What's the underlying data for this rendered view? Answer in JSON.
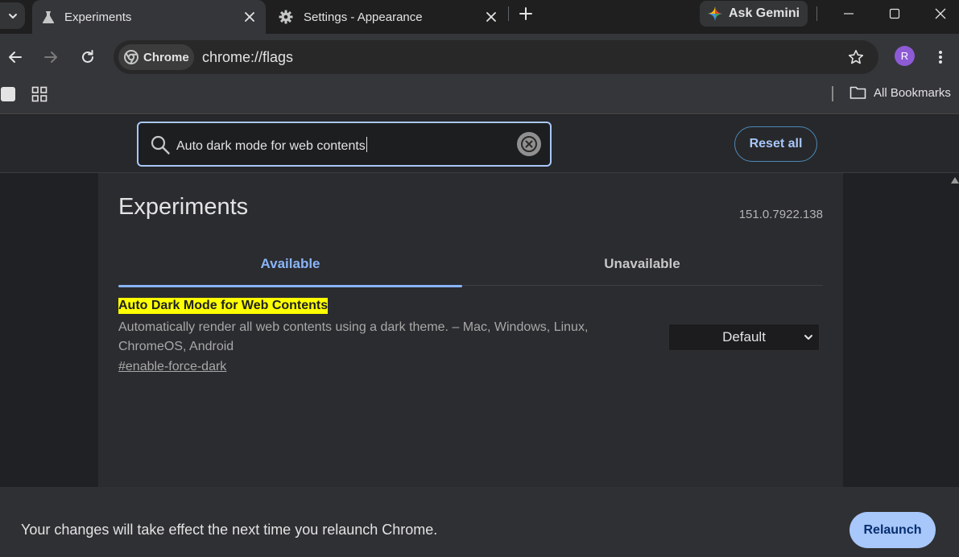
{
  "tabs": [
    {
      "title": "Experiments",
      "icon": "flask-icon",
      "active": true
    },
    {
      "title": "Settings - Appearance",
      "icon": "gear-icon",
      "active": false
    }
  ],
  "gemini": {
    "label": "Ask Gemini"
  },
  "omnibox": {
    "chip_label": "Chrome",
    "url": "chrome://flags"
  },
  "profile": {
    "initial": "R",
    "color": "#8e5bd6"
  },
  "bookmarks": {
    "all_label": "All Bookmarks"
  },
  "flags": {
    "search_value": "Auto dark mode for web contents",
    "reset_label": "Reset all",
    "page_title": "Experiments",
    "version": "151.0.7922.138",
    "tabs": [
      {
        "label": "Available",
        "selected": true
      },
      {
        "label": "Unavailable",
        "selected": false
      }
    ],
    "items": [
      {
        "name": "Auto Dark Mode for Web Contents",
        "description": "Automatically render all web contents using a dark theme. – Mac, Windows, Linux, ChromeOS, Android",
        "link": "#enable-force-dark",
        "selected_option": "Default"
      }
    ]
  },
  "relaunch": {
    "message": "Your changes will take effect the next time you relaunch Chrome.",
    "button_label": "Relaunch"
  },
  "colors": {
    "accent": "#a8c7fa",
    "highlight": "#ffff00",
    "link_tab": "#8ab4f8"
  }
}
